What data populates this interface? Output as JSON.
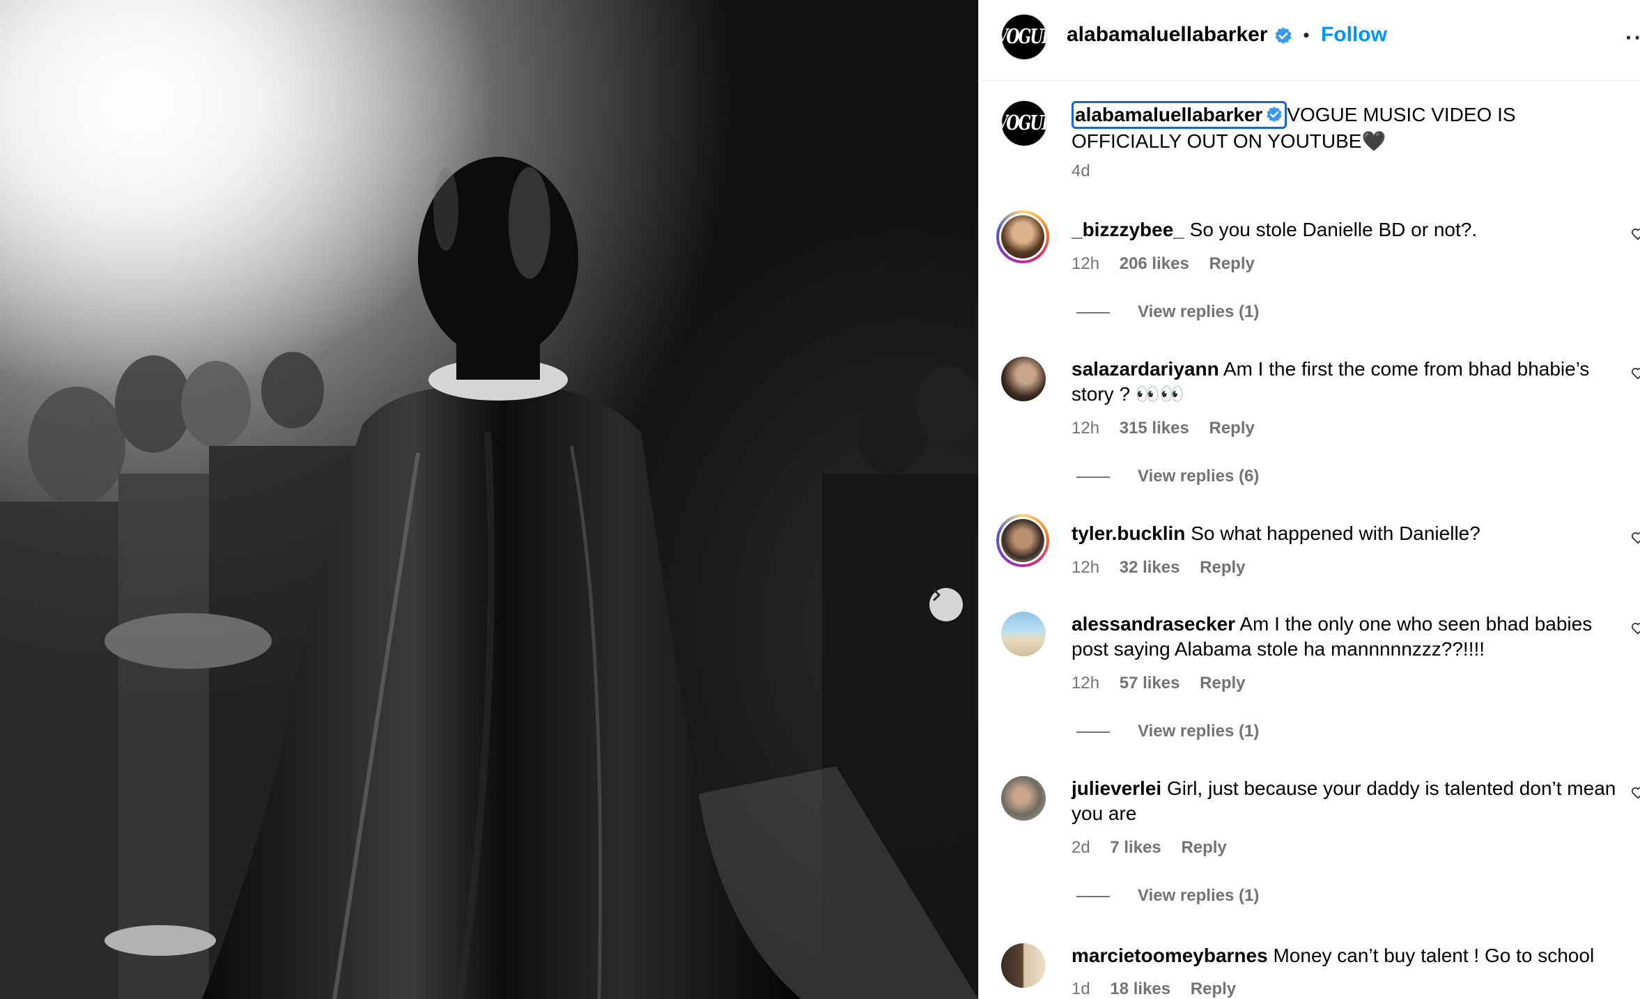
{
  "colors": {
    "accent": "#0095f6",
    "verified": "#3897f0",
    "secondary_text": "#737373",
    "focus_outline": "#1a64d3"
  },
  "post": {
    "author": "alabamaluellabarker",
    "avatar_text": "VOGUE",
    "follow_label": "Follow",
    "separator": "•",
    "more_label": "···",
    "caption": "VOGUE MUSIC VIDEO IS OFFICIALLY OUT ON YOUTUBE🖤",
    "caption_time": "4d",
    "next_icon": "chevron-right-icon"
  },
  "comments": [
    {
      "user": "_bizzzybee_",
      "text": "So you stole Danielle BD or not?.",
      "time": "12h",
      "likes": "206 likes",
      "reply": "Reply",
      "view_replies": "View replies (1)",
      "story_ring": true
    },
    {
      "user": "salazardariyann",
      "text": "Am I the first the come from bhad bhabie’s story ? 👀👀",
      "time": "12h",
      "likes": "315 likes",
      "reply": "Reply",
      "view_replies": "View replies (6)",
      "story_ring": false
    },
    {
      "user": "tyler.bucklin",
      "text": "So what happened with Danielle?",
      "time": "12h",
      "likes": "32 likes",
      "reply": "Reply",
      "view_replies": "",
      "story_ring": true
    },
    {
      "user": "alessandrasecker",
      "text": "Am I the only one who seen bhad babies post saying Alabama stole ha mannnnnzzz??!!!!",
      "time": "12h",
      "likes": "57 likes",
      "reply": "Reply",
      "view_replies": "View replies (1)",
      "story_ring": false
    },
    {
      "user": "julieverlei",
      "text": "Girl, just because your daddy is talented don’t mean you are",
      "time": "2d",
      "likes": "7 likes",
      "reply": "Reply",
      "view_replies": "View replies (1)",
      "story_ring": false
    },
    {
      "user": "marcietoomeybarnes",
      "text": "Money can’t buy talent ! Go to school",
      "time": "1d",
      "likes": "18 likes",
      "reply": "Reply",
      "view_replies": "",
      "story_ring": false
    }
  ]
}
